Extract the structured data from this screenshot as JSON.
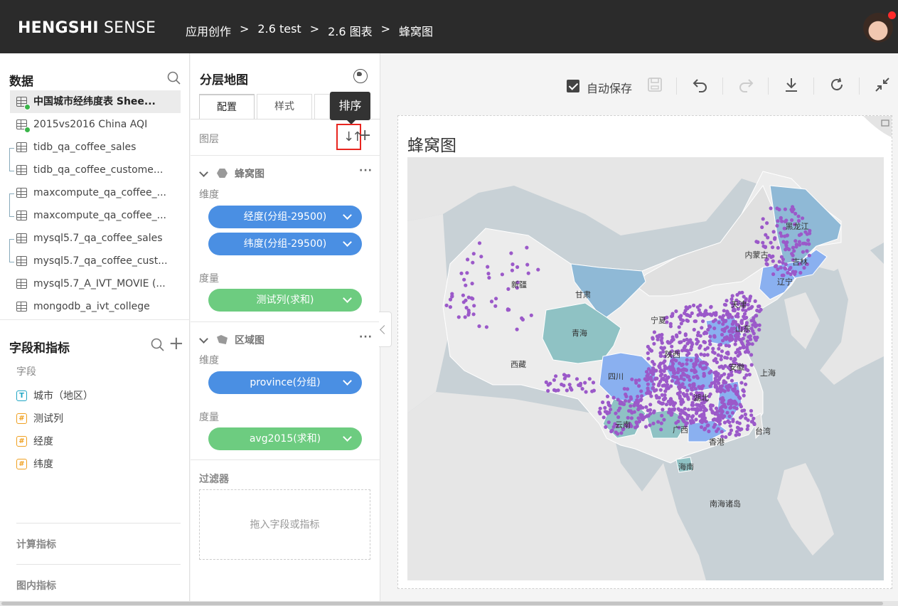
{
  "header": {
    "logo_bold": "HENGSHI",
    "logo_light": " SENSE",
    "breadcrumbs": [
      "应用创作",
      "2.6 test",
      "2.6 图表",
      "蜂窝图"
    ],
    "separator": ">"
  },
  "data_panel": {
    "title": "数据",
    "datasets": [
      {
        "name": "中国城市经纬度表 Shee...",
        "active": true,
        "status": "ok"
      },
      {
        "name": "2015vs2016 China AQI",
        "active": false,
        "status": "ok"
      },
      {
        "name": "tidb_qa_coffee_sales",
        "active": false
      },
      {
        "name": "tidb_qa_coffee_custome...",
        "active": false
      },
      {
        "name": "maxcompute_qa_coffee_...",
        "active": false
      },
      {
        "name": "maxcompute_qa_coffee_...",
        "active": false
      },
      {
        "name": "mysql5.7_qa_coffee_sales",
        "active": false
      },
      {
        "name": "mysql5.7_qa_coffee_cust...",
        "active": false
      },
      {
        "name": "mysql5.7_A_IVT_MOVIE (...",
        "active": false
      },
      {
        "name": "mongodb_a_ivt_college",
        "active": false
      }
    ]
  },
  "fields_panel": {
    "title": "字段和指标",
    "fields_label": "字段",
    "fields": [
      {
        "type": "T",
        "name": "城市（地区）"
      },
      {
        "type": "#",
        "name": "测试列"
      },
      {
        "type": "#",
        "name": "经度"
      },
      {
        "type": "#",
        "name": "纬度"
      }
    ],
    "calc_metrics": "计算指标",
    "chart_metrics": "图内指标"
  },
  "config_panel": {
    "title": "分层地图",
    "tabs": [
      "配置",
      "样式",
      ""
    ],
    "tooltip": "排序",
    "layers_label": "图层",
    "sort_glyph": "↓↑",
    "add_glyph": "+",
    "layers": [
      {
        "name": "蜂窝图",
        "dimension_label": "维度",
        "dimensions": [
          "经度(分组-29500)",
          "纬度(分组-29500)"
        ],
        "measure_label": "度量",
        "measures": [
          "测试列(求和)"
        ]
      },
      {
        "name": "区域图",
        "dimension_label": "维度",
        "dimensions": [
          "province(分组)"
        ],
        "measure_label": "度量",
        "measures": [
          "avg2015(求和)"
        ]
      }
    ],
    "more_glyph": "···",
    "filter_label": "过滤器",
    "filter_placeholder": "拖入字段或指标"
  },
  "toolbar": {
    "autosave_label": "自动保存",
    "autosave_checked": true
  },
  "chart": {
    "title": "蜂窝图",
    "map_labels": {
      "heilongjiang": "黑龙江",
      "jilin": "吉林",
      "liaoning": "辽宁",
      "neimenggu": "内蒙古",
      "xinjiang": "新疆",
      "gansu": "甘肃",
      "qinghai": "青海",
      "xizang": "西藏",
      "ningxia": "宁夏",
      "shanxi": "陕西",
      "tianjin": "天津",
      "shandong": "山东",
      "sichuan": "四川",
      "anhui": "安徽",
      "shanghai": "上海",
      "hubei": "湖北",
      "yunnan": "云南",
      "guangxi": "广西",
      "hong_kong": "香港",
      "taiwan": "台湾",
      "hainan": "海南",
      "south_china_sea": "南海诸岛"
    },
    "colors": {
      "hex": "#9b59c9",
      "region_teal": "#8fc2c4",
      "region_blue": "#8ab0f0",
      "region_steel": "#8fb9d6",
      "land": "#ececec",
      "sea": "#c8d1d6"
    }
  }
}
